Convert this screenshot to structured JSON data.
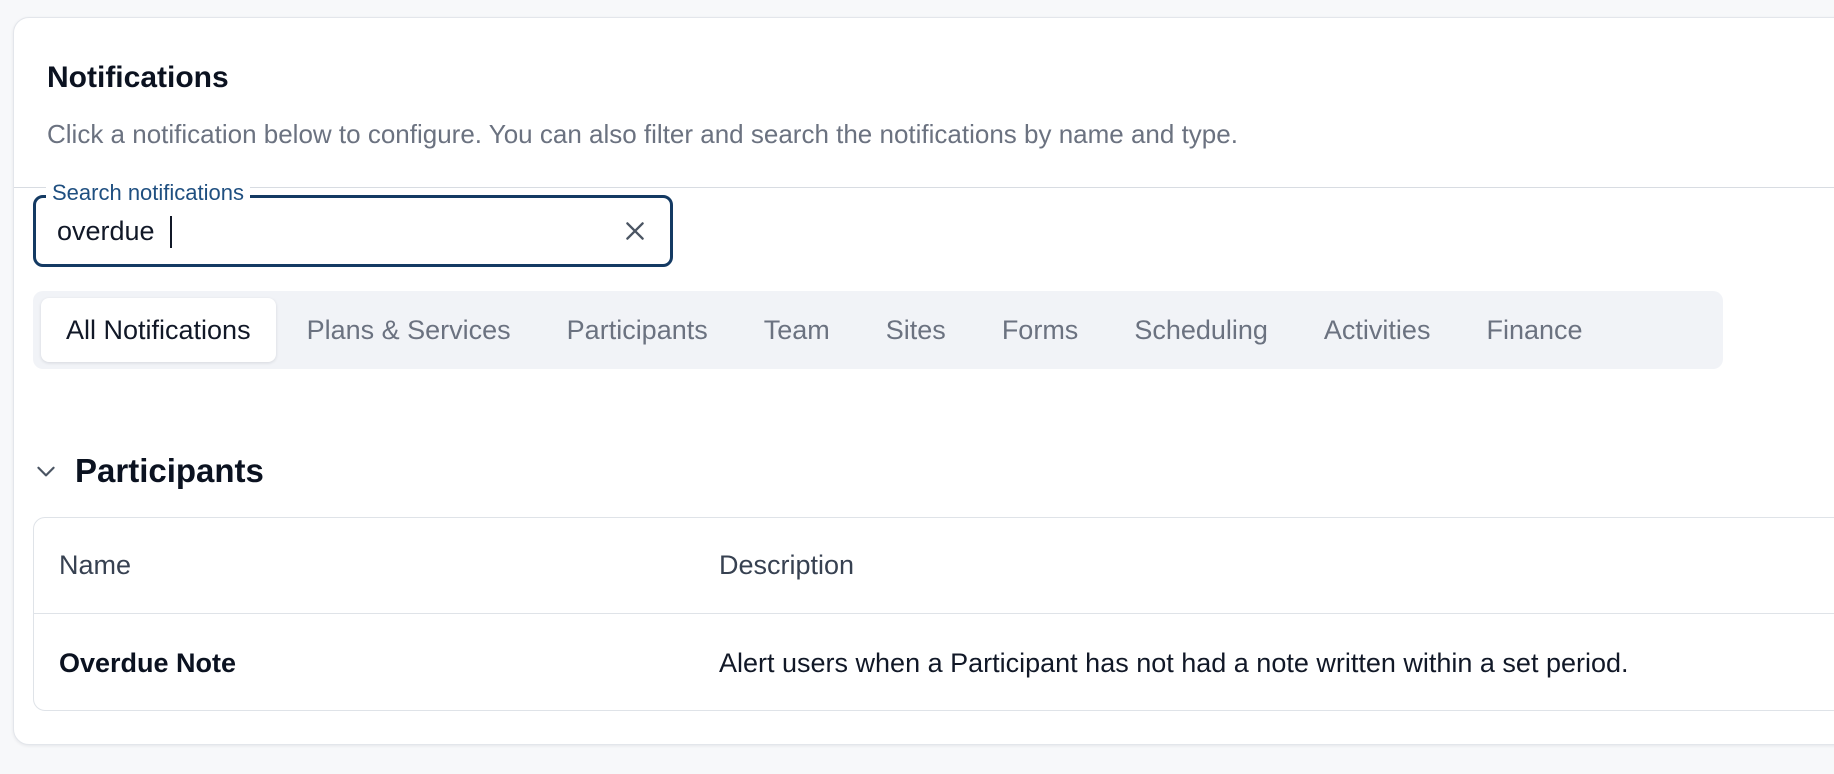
{
  "header": {
    "title": "Notifications",
    "subtitle": "Click a notification below to configure. You can also filter and search the notifications by name and type."
  },
  "search": {
    "label": "Search notifications",
    "value": "overdue",
    "clear_icon": "close-icon"
  },
  "tabs": [
    {
      "label": "All Notifications",
      "active": true
    },
    {
      "label": "Plans & Services",
      "active": false
    },
    {
      "label": "Participants",
      "active": false
    },
    {
      "label": "Team",
      "active": false
    },
    {
      "label": "Sites",
      "active": false
    },
    {
      "label": "Forms",
      "active": false
    },
    {
      "label": "Scheduling",
      "active": false
    },
    {
      "label": "Activities",
      "active": false
    },
    {
      "label": "Finance",
      "active": false
    }
  ],
  "section": {
    "title": "Participants",
    "expanded": true,
    "toggle_icon": "chevron-down-icon"
  },
  "table": {
    "columns": {
      "name": "Name",
      "description": "Description"
    },
    "rows": [
      {
        "name": "Overdue Note",
        "description": "Alert users when a Participant has not had a note written within a set period."
      }
    ]
  },
  "colors": {
    "accent": "#143a63",
    "muted_text": "#6b7280",
    "tab_bg": "#f1f3f7"
  }
}
